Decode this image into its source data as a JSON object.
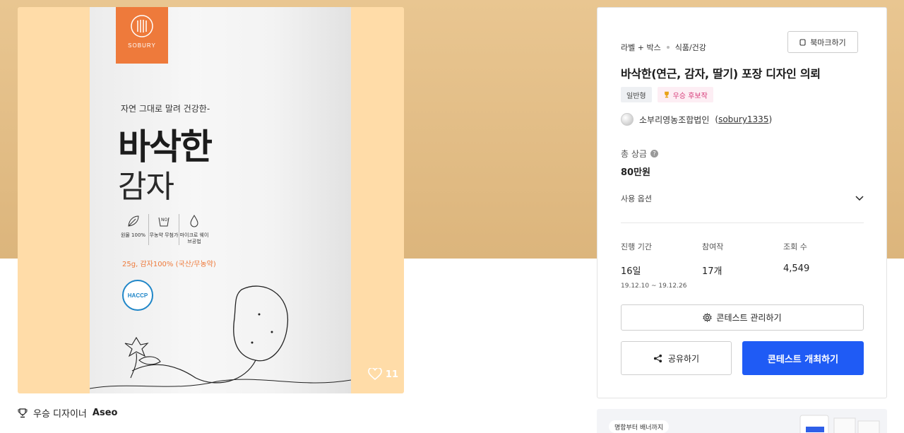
{
  "product_image": {
    "brand": "SOBURY",
    "tagline": "자연 그대로 말려 건강한-",
    "name_main": "바삭한",
    "name_sub": "감자",
    "features": [
      "원물 100%",
      "무농약 무첨가",
      "마이크로 웨이브공법"
    ],
    "weight_line": "25g, 감자100% (국산/무농약)",
    "certification": "HACCP",
    "likes": "11"
  },
  "designer": {
    "prefix": "우승 디자이너",
    "name": "Aseo"
  },
  "panel": {
    "category_1": "라벨 + 박스",
    "category_2": "식품/건강",
    "bookmark_label": "북마크하기",
    "title": "바삭한(연근, 감자, 딸기) 포장 디자인 의뢰",
    "badge_type": "일반형",
    "badge_winner": "우승 후보작",
    "owner_name": "소부리영농조합법인",
    "owner_id": "sobury1335",
    "prize_label": "총 상금",
    "prize_value": "80만원",
    "usage_label": "사용 옵션",
    "stats": [
      {
        "label": "진행 기간",
        "value": "16일",
        "sub": "19.12.10 ~ 19.12.26"
      },
      {
        "label": "참여작",
        "value": "17개",
        "sub": ""
      },
      {
        "label": "조회 수",
        "value": "4,549",
        "sub": ""
      }
    ],
    "manage_label": "콘테스트 관리하기",
    "share_label": "공유하기",
    "open_label": "콘테스트 개최하기"
  },
  "banner": {
    "pill_text": "명함부터 배너까지"
  },
  "colors": {
    "primary": "#1f5bf5",
    "brand_orange": "#ee7a3b",
    "header_band": "#e9c691",
    "image_bg": "#ffdca8"
  }
}
